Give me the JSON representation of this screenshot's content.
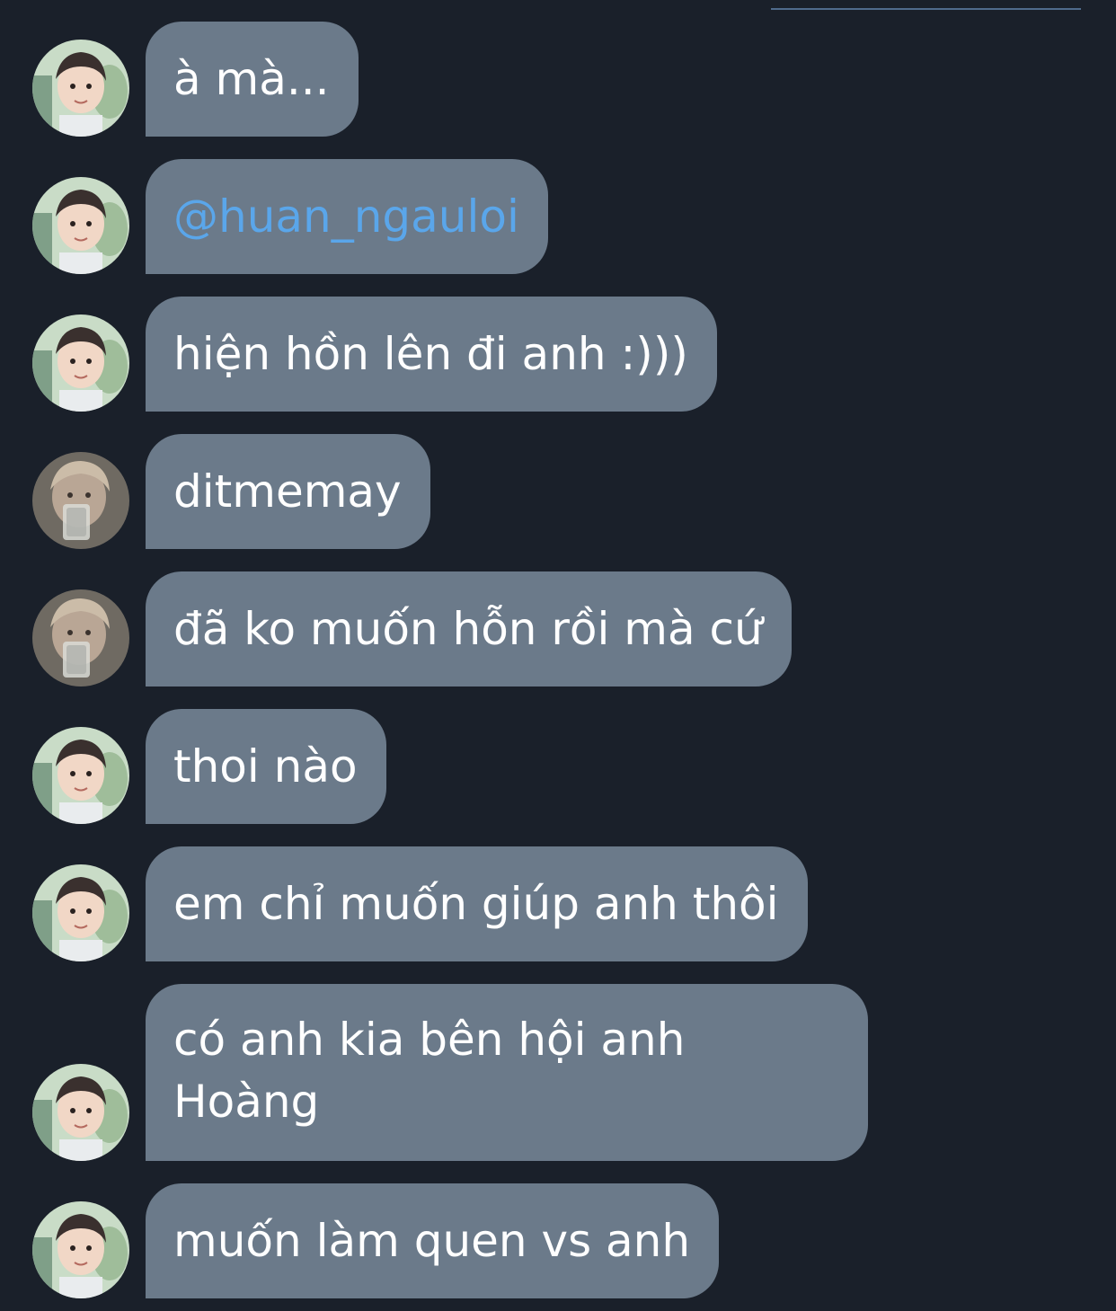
{
  "colors": {
    "background": "#1a202a",
    "bubble": "#6b7a8a",
    "text": "#ffffff",
    "mention": "#5aa6ea",
    "top_line": "#4f6b8c"
  },
  "messages": [
    {
      "text": "à mà...",
      "avatar": "avatar-boy-icon"
    },
    {
      "text": "@huan_ngauloi",
      "avatar": "avatar-boy-icon",
      "is_mention": true
    },
    {
      "text": "hiện hồn lên đi anh :)))",
      "avatar": "avatar-boy-icon"
    },
    {
      "text": "ditmemay",
      "avatar": "avatar-glass-icon"
    },
    {
      "text": "đã ko muốn hỗn rồi mà cứ",
      "avatar": "avatar-glass-icon"
    },
    {
      "text": "thoi nào",
      "avatar": "avatar-boy-icon"
    },
    {
      "text": "em chỉ muốn giúp anh thôi",
      "avatar": "avatar-boy-icon"
    },
    {
      "text_line1": "có anh kia bên hội anh",
      "text_line2": "Hoàng",
      "avatar": "avatar-boy-icon"
    },
    {
      "text": "muốn làm quen vs anh",
      "avatar": "avatar-boy-icon"
    }
  ]
}
